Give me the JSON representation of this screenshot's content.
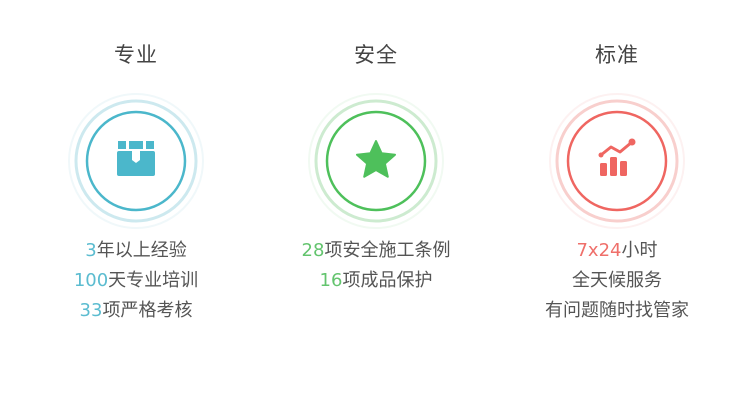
{
  "columns": [
    {
      "title": "专业",
      "icon": "box-icon",
      "accent": "#4bb7cb",
      "lines": [
        {
          "num": "3",
          "text": "年以上经验"
        },
        {
          "num": "100",
          "text": "天专业培训"
        },
        {
          "num": "33",
          "text": "项严格考核"
        }
      ]
    },
    {
      "title": "安全",
      "icon": "star-icon",
      "accent": "#4ec05b",
      "lines": [
        {
          "num": "28",
          "text": "项安全施工条例"
        },
        {
          "num": "16",
          "text": "项成品保护"
        }
      ]
    },
    {
      "title": "标准",
      "icon": "chart-icon",
      "accent": "#ef6661",
      "lines": [
        {
          "num": "7x24",
          "text": "小时"
        },
        {
          "num": "",
          "text": "全天候服务"
        },
        {
          "num": "",
          "text": "有问题随时找管家"
        }
      ]
    }
  ]
}
